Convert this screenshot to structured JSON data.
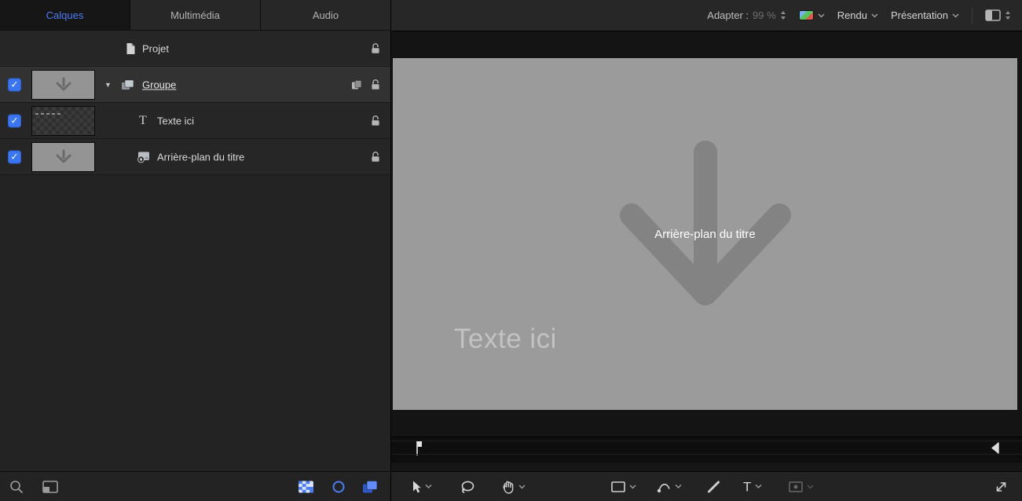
{
  "colors": {
    "accent": "#4a7cf7",
    "stage_gray": "#9b9b9b",
    "arrow_gray": "#838383"
  },
  "tabs": [
    {
      "label": "Calques",
      "active": true
    },
    {
      "label": "Multimédia",
      "active": false
    },
    {
      "label": "Audio",
      "active": false
    }
  ],
  "layers": {
    "rows": [
      {
        "label": "Projet",
        "type": "project",
        "checked": false,
        "locked": false
      },
      {
        "label": "Groupe",
        "type": "group",
        "checked": true,
        "selected": true,
        "locked": false
      },
      {
        "label": "Texte ici",
        "type": "text",
        "checked": true,
        "locked": false
      },
      {
        "label": "Arrière-plan du titre",
        "type": "media",
        "checked": true,
        "locked": false
      }
    ]
  },
  "top_toolbar": {
    "fit_label": "Adapter :",
    "zoom_value": "99 %",
    "render_label": "Rendu",
    "view_label": "Présentation"
  },
  "canvas": {
    "background_label": "Arrière-plan du titre",
    "text_placeholder": "Texte ici"
  },
  "icons": {
    "check": "✓",
    "disclosure_open": "▼",
    "chevron_down": "⌄",
    "text_tool": "T",
    "named": [
      "magnifier-icon",
      "frame-icon",
      "checkerboard-icon",
      "circle-icon",
      "layers-icon",
      "lock-open-icon",
      "document-icon",
      "group-icon",
      "media-icon",
      "playhead-marker",
      "end-range-marker",
      "select-arrow-icon",
      "adjust-tool-icon",
      "hand-tool-icon",
      "rect-tool-icon",
      "bezier-tool-icon",
      "stroke-tool-icon",
      "text-tool-icon",
      "shape-tool-icon",
      "expand-icon",
      "color-swatch",
      "stepper-icon"
    ]
  }
}
